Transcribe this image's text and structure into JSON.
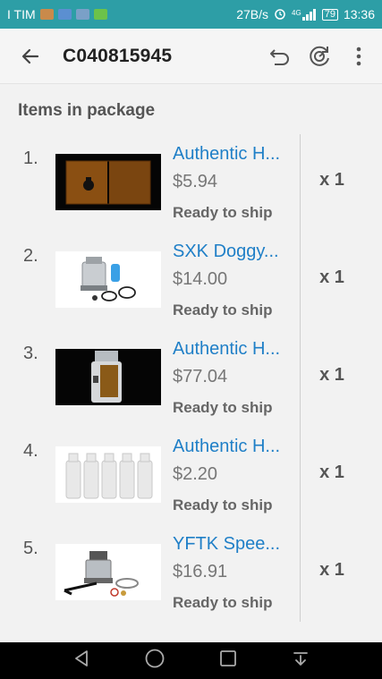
{
  "status_bar": {
    "carrier": "I TIM",
    "speed": "27B/s",
    "network": "4G",
    "battery": "79",
    "time": "13:36"
  },
  "app_bar": {
    "title": "C040815945",
    "icons": [
      "back-arrow-icon",
      "undo-icon",
      "refresh-icon",
      "more-vert-icon"
    ]
  },
  "section": {
    "title": "Items in package"
  },
  "items": [
    {
      "num": "1.",
      "name": "Authentic H...",
      "price": "$5.94",
      "status": "Ready to ship",
      "qty": "x 1",
      "thumb": "wood-panels"
    },
    {
      "num": "2.",
      "name": "SXK Doggy...",
      "price": "$14.00",
      "status": "Ready to ship",
      "qty": "x 1",
      "thumb": "tank-atomizer"
    },
    {
      "num": "3.",
      "name": "Authentic H...",
      "price": "$77.04",
      "status": "Ready to ship",
      "qty": "x 1",
      "thumb": "box-mod"
    },
    {
      "num": "4.",
      "name": "Authentic H...",
      "price": "$2.20",
      "status": "Ready to ship",
      "qty": "x 1",
      "thumb": "bottles"
    },
    {
      "num": "5.",
      "name": "YFTK Spee...",
      "price": "$16.91",
      "status": "Ready to ship",
      "qty": "x 1",
      "thumb": "rda-atomizer"
    }
  ],
  "colors": {
    "status_bar": "#2d9ea6",
    "link": "#1f7fc7",
    "background": "#f2f2f2"
  }
}
